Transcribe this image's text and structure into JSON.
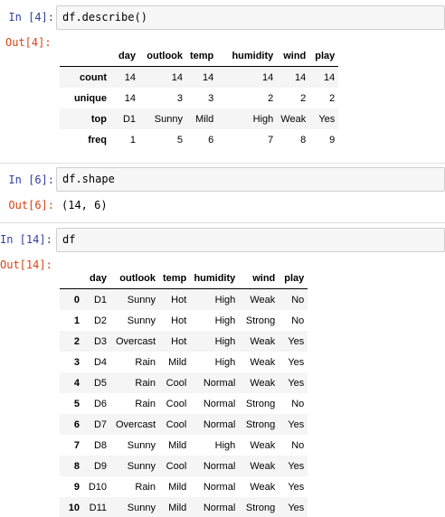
{
  "cells": [
    {
      "in_prompt": "In [4]:",
      "code": "df.describe()",
      "out_prompt": "Out[4]:",
      "table": {
        "columns": [
          "day",
          "outlook",
          "temp",
          "humidity",
          "wind",
          "play"
        ],
        "rows": [
          {
            "index": "count",
            "values": [
              "14",
              "14",
              "14",
              "14",
              "14",
              "14"
            ]
          },
          {
            "index": "unique",
            "values": [
              "14",
              "3",
              "3",
              "2",
              "2",
              "2"
            ]
          },
          {
            "index": "top",
            "values": [
              "D1",
              "Sunny",
              "Mild",
              "High",
              "Weak",
              "Yes"
            ]
          },
          {
            "index": "freq",
            "values": [
              "1",
              "5",
              "6",
              "7",
              "8",
              "9"
            ]
          }
        ]
      }
    },
    {
      "in_prompt": "In [6]:",
      "code": "df.shape",
      "out_prompt": "Out[6]:",
      "text_output": "(14, 6)"
    },
    {
      "in_prompt": "In [14]:",
      "code": "df",
      "out_prompt": "Out[14]:",
      "table": {
        "columns": [
          "day",
          "outlook",
          "temp",
          "humidity",
          "wind",
          "play"
        ],
        "rows": [
          {
            "index": "0",
            "values": [
              "D1",
              "Sunny",
              "Hot",
              "High",
              "Weak",
              "No"
            ]
          },
          {
            "index": "1",
            "values": [
              "D2",
              "Sunny",
              "Hot",
              "High",
              "Strong",
              "No"
            ]
          },
          {
            "index": "2",
            "values": [
              "D3",
              "Overcast",
              "Hot",
              "High",
              "Weak",
              "Yes"
            ]
          },
          {
            "index": "3",
            "values": [
              "D4",
              "Rain",
              "Mild",
              "High",
              "Weak",
              "Yes"
            ]
          },
          {
            "index": "4",
            "values": [
              "D5",
              "Rain",
              "Cool",
              "Normal",
              "Weak",
              "Yes"
            ]
          },
          {
            "index": "5",
            "values": [
              "D6",
              "Rain",
              "Cool",
              "Normal",
              "Strong",
              "No"
            ]
          },
          {
            "index": "6",
            "values": [
              "D7",
              "Overcast",
              "Cool",
              "Normal",
              "Strong",
              "Yes"
            ]
          },
          {
            "index": "7",
            "values": [
              "D8",
              "Sunny",
              "Mild",
              "High",
              "Weak",
              "No"
            ]
          },
          {
            "index": "8",
            "values": [
              "D9",
              "Sunny",
              "Cool",
              "Normal",
              "Weak",
              "Yes"
            ]
          },
          {
            "index": "9",
            "values": [
              "D10",
              "Rain",
              "Mild",
              "Normal",
              "Weak",
              "Yes"
            ]
          },
          {
            "index": "10",
            "values": [
              "D11",
              "Sunny",
              "Mild",
              "Normal",
              "Strong",
              "Yes"
            ]
          }
        ]
      }
    }
  ],
  "colors": {
    "in_prompt": "#303f9f",
    "out_prompt": "#d84315",
    "input_bg": "#f7f7f7",
    "stripe_bg": "#f5f5f5"
  }
}
